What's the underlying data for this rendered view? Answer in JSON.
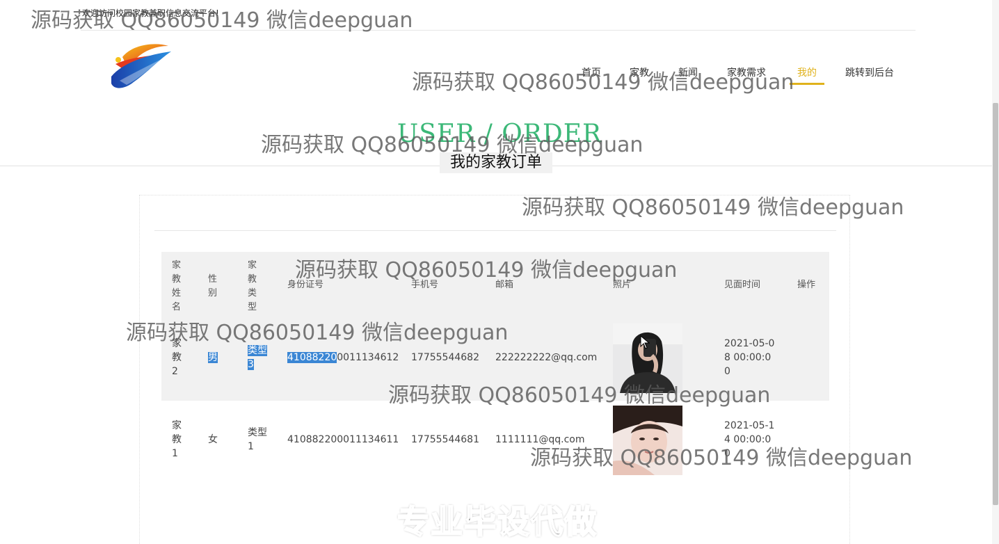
{
  "header": {
    "welcome": "欢迎访问校园家教兼职信息交流平台!"
  },
  "nav": {
    "items": [
      "首页",
      "家教",
      "新闻",
      "家教需求",
      "我的",
      "跳转到后台"
    ],
    "active": "我的"
  },
  "section": {
    "title": "USER / ORDER",
    "subtitle": "我的家教订单"
  },
  "table": {
    "headers": {
      "name": "家教姓名",
      "sex": "性别",
      "type": "家教类型",
      "id": "身份证号",
      "phone": "手机号",
      "email": "邮箱",
      "photo": "照片",
      "time": "见面时间",
      "op": "操作"
    },
    "rows": [
      {
        "name": "家教2",
        "sex": "男",
        "type": "类型3",
        "id_selected": "41088220",
        "id_rest": "0011134612",
        "phone": "17755544682",
        "email": "222222222@qq.com",
        "time": "2021-05-08 00:00:00"
      },
      {
        "name": "家教1",
        "sex": "女",
        "type": "类型1",
        "id": "410882200011134611",
        "phone": "17755544681",
        "email": "1111111@qq.com",
        "time": "2021-05-14 00:00:00"
      }
    ]
  },
  "watermarks": {
    "text": "源码获取 QQ86050149 微信deepguan",
    "ad": "专业毕设代做"
  },
  "colors": {
    "accent": "#e0b21c",
    "title_green": "#3cb878",
    "selection": "#3a86d4"
  }
}
